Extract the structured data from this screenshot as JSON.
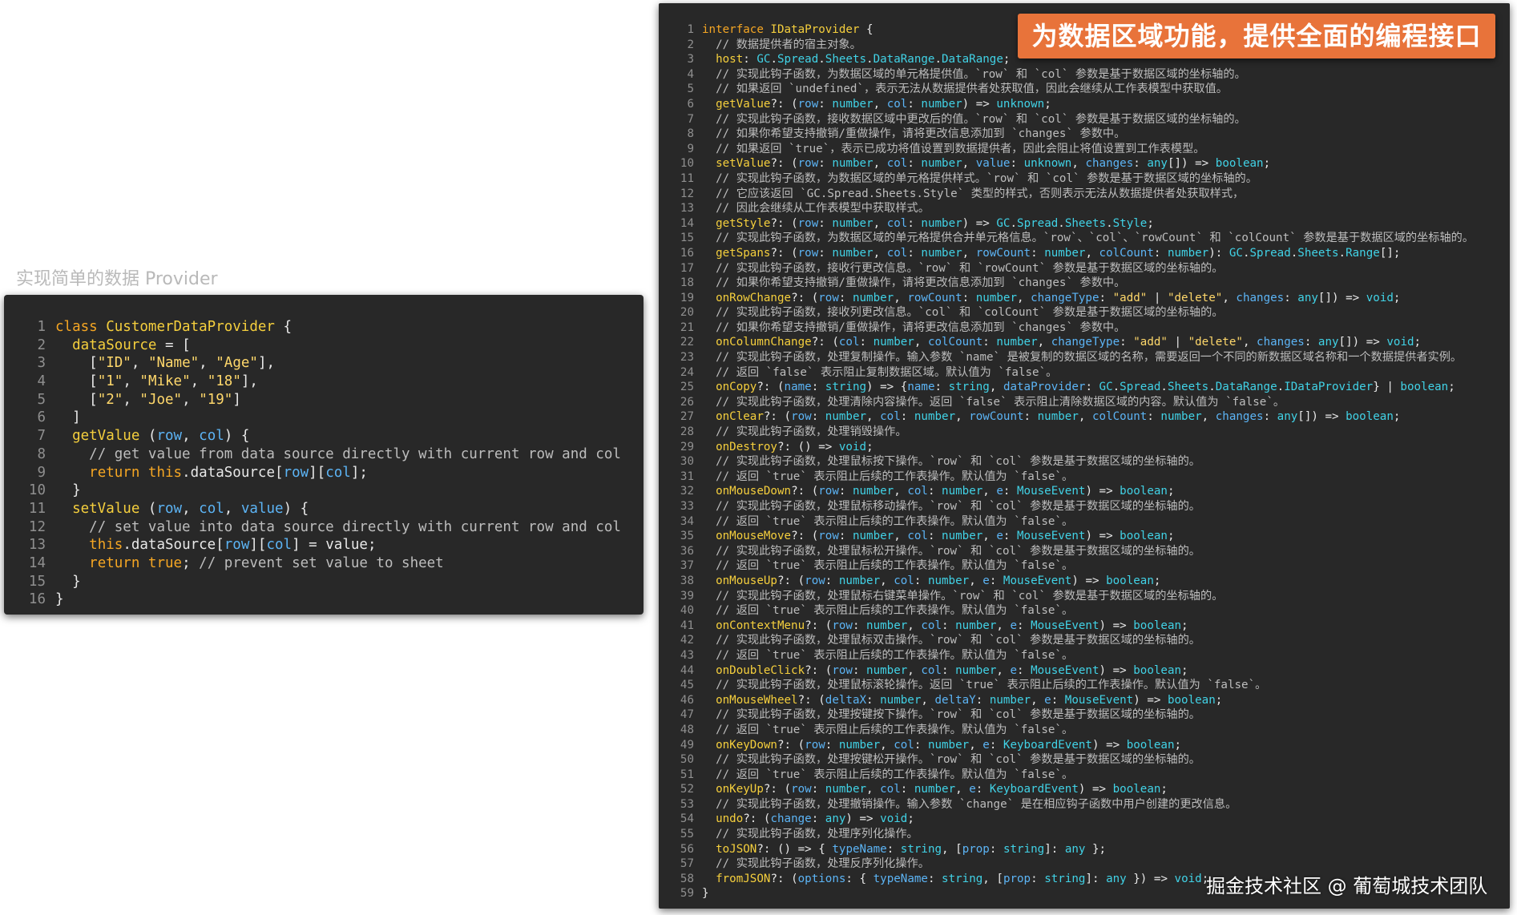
{
  "caption": "实现简单的数据 Provider",
  "banner": "为数据区域功能，提供全面的编程接口",
  "watermark": "掘金技术社区 @ 葡萄城技术团队",
  "colors": {
    "panel_bg": "#282828",
    "banner_bg": "#e8733a",
    "keyword": "#f5a623",
    "identifier": "#f5cf3d",
    "string": "#ffd86b",
    "param": "#5cb4f5",
    "type": "#41d2e6",
    "comment": "#bdbdbd"
  },
  "left_code": [
    {
      "n": "1",
      "t": "class CustomerDataProvider {"
    },
    {
      "n": "2",
      "t": "  dataSource = ["
    },
    {
      "n": "3",
      "t": "    [\"ID\", \"Name\", \"Age\"],"
    },
    {
      "n": "4",
      "t": "    [\"1\", \"Mike\", \"18\"],"
    },
    {
      "n": "5",
      "t": "    [\"2\", \"Joe\", \"19\"]"
    },
    {
      "n": "6",
      "t": "  ]"
    },
    {
      "n": "7",
      "t": "  getValue (row, col) {"
    },
    {
      "n": "8",
      "t": "    // get value from data source directly with current row and col"
    },
    {
      "n": "9",
      "t": "    return this.dataSource[row][col];"
    },
    {
      "n": "10",
      "t": "  }"
    },
    {
      "n": "11",
      "t": "  setValue (row, col, value) {"
    },
    {
      "n": "12",
      "t": "    // set value into data source directly with current row and col"
    },
    {
      "n": "13",
      "t": "    this.dataSource[row][col] = value;"
    },
    {
      "n": "14",
      "t": "    return true; // prevent set value to sheet"
    },
    {
      "n": "15",
      "t": "  }"
    },
    {
      "n": "16",
      "t": "}"
    }
  ],
  "right_code": [
    {
      "n": "1",
      "t": "interface IDataProvider {"
    },
    {
      "n": "2",
      "t": "  // 数据提供者的宿主对象。"
    },
    {
      "n": "3",
      "t": "  host: GC.Spread.Sheets.DataRange.DataRange;"
    },
    {
      "n": "4",
      "t": "  // 实现此钩子函数，为数据区域的单元格提供值。`row` 和 `col` 参数是基于数据区域的坐标轴的。"
    },
    {
      "n": "5",
      "t": "  // 如果返回 `undefined`，表示无法从数据提供者处获取值，因此会继续从工作表模型中获取值。"
    },
    {
      "n": "6",
      "t": "  getValue?: (row: number, col: number) => unknown;"
    },
    {
      "n": "7",
      "t": "  // 实现此钩子函数，接收数据区域中更改后的值。`row` 和 `col` 参数是基于数据区域的坐标轴的。"
    },
    {
      "n": "8",
      "t": "  // 如果你希望支持撤销/重做操作，请将更改信息添加到 `changes` 参数中。"
    },
    {
      "n": "9",
      "t": "  // 如果返回 `true`，表示已成功将值设置到数据提供者，因此会阻止将值设置到工作表模型。"
    },
    {
      "n": "10",
      "t": "  setValue?: (row: number, col: number, value: unknown, changes: any[]) => boolean;"
    },
    {
      "n": "11",
      "t": "  // 实现此钩子函数，为数据区域的单元格提供样式。`row` 和 `col` 参数是基于数据区域的坐标轴的。"
    },
    {
      "n": "12",
      "t": "  // 它应该返回 `GC.Spread.Sheets.Style` 类型的样式，否则表示无法从数据提供者处获取样式，"
    },
    {
      "n": "13",
      "t": "  // 因此会继续从工作表模型中获取样式。"
    },
    {
      "n": "14",
      "t": "  getStyle?: (row: number, col: number) => GC.Spread.Sheets.Style;"
    },
    {
      "n": "15",
      "t": "  // 实现此钩子函数，为数据区域的单元格提供合并单元格信息。`row`、`col`、`rowCount` 和 `colCount` 参数是基于数据区域的坐标轴的。"
    },
    {
      "n": "16",
      "t": "  getSpans?: (row: number, col: number, rowCount: number, colCount: number): GC.Spread.Sheets.Range[];"
    },
    {
      "n": "17",
      "t": "  // 实现此钩子函数，接收行更改信息。`row` 和 `rowCount` 参数是基于数据区域的坐标轴的。"
    },
    {
      "n": "18",
      "t": "  // 如果你希望支持撤销/重做操作，请将更改信息添加到 `changes` 参数中。"
    },
    {
      "n": "19",
      "t": "  onRowChange?: (row: number, rowCount: number, changeType: \"add\" | \"delete\", changes: any[]) => void;"
    },
    {
      "n": "20",
      "t": "  // 实现此钩子函数，接收列更改信息。`col` 和 `colCount` 参数是基于数据区域的坐标轴的。"
    },
    {
      "n": "21",
      "t": "  // 如果你希望支持撤销/重做操作，请将更改信息添加到 `changes` 参数中。"
    },
    {
      "n": "22",
      "t": "  onColumnChange?: (col: number, colCount: number, changeType: \"add\" | \"delete\", changes: any[]) => void;"
    },
    {
      "n": "23",
      "t": "  // 实现此钩子函数，处理复制操作。输入参数 `name` 是被复制的数据区域的名称，需要返回一个不同的新数据区域名称和一个数据提供者实例。"
    },
    {
      "n": "24",
      "t": "  // 返回 `false` 表示阻止复制数据区域。默认值为 `false`。"
    },
    {
      "n": "25",
      "t": "  onCopy?: (name: string) => {name: string, dataProvider: GC.Spread.Sheets.DataRange.IDataProvider} | boolean;"
    },
    {
      "n": "26",
      "t": "  // 实现此钩子函数，处理清除内容操作。返回 `false` 表示阻止清除数据区域的内容。默认值为 `false`。"
    },
    {
      "n": "27",
      "t": "  onClear?: (row: number, col: number, rowCount: number, colCount: number, changes: any[]) => boolean;"
    },
    {
      "n": "28",
      "t": "  // 实现此钩子函数，处理销毁操作。"
    },
    {
      "n": "29",
      "t": "  onDestroy?: () => void;"
    },
    {
      "n": "30",
      "t": "  // 实现此钩子函数，处理鼠标按下操作。`row` 和 `col` 参数是基于数据区域的坐标轴的。"
    },
    {
      "n": "31",
      "t": "  // 返回 `true` 表示阻止后续的工作表操作。默认值为 `false`。"
    },
    {
      "n": "32",
      "t": "  onMouseDown?: (row: number, col: number, e: MouseEvent) => boolean;"
    },
    {
      "n": "33",
      "t": "  // 实现此钩子函数，处理鼠标移动操作。`row` 和 `col` 参数是基于数据区域的坐标轴的。"
    },
    {
      "n": "34",
      "t": "  // 返回 `true` 表示阻止后续的工作表操作。默认值为 `false`。"
    },
    {
      "n": "35",
      "t": "  onMouseMove?: (row: number, col: number, e: MouseEvent) => boolean;"
    },
    {
      "n": "36",
      "t": "  // 实现此钩子函数，处理鼠标松开操作。`row` 和 `col` 参数是基于数据区域的坐标轴的。"
    },
    {
      "n": "37",
      "t": "  // 返回 `true` 表示阻止后续的工作表操作。默认值为 `false`。"
    },
    {
      "n": "38",
      "t": "  onMouseUp?: (row: number, col: number, e: MouseEvent) => boolean;"
    },
    {
      "n": "39",
      "t": "  // 实现此钩子函数，处理鼠标右键菜单操作。`row` 和 `col` 参数是基于数据区域的坐标轴的。"
    },
    {
      "n": "40",
      "t": "  // 返回 `true` 表示阻止后续的工作表操作。默认值为 `false`。"
    },
    {
      "n": "41",
      "t": "  onContextMenu?: (row: number, col: number, e: MouseEvent) => boolean;"
    },
    {
      "n": "42",
      "t": "  // 实现此钩子函数，处理鼠标双击操作。`row` 和 `col` 参数是基于数据区域的坐标轴的。"
    },
    {
      "n": "43",
      "t": "  // 返回 `true` 表示阻止后续的工作表操作。默认值为 `false`。"
    },
    {
      "n": "44",
      "t": "  onDoubleClick?: (row: number, col: number, e: MouseEvent) => boolean;"
    },
    {
      "n": "45",
      "t": "  // 实现此钩子函数，处理鼠标滚轮操作。返回 `true` 表示阻止后续的工作表操作。默认值为 `false`。"
    },
    {
      "n": "46",
      "t": "  onMouseWheel?: (deltaX: number, deltaY: number, e: MouseEvent) => boolean;"
    },
    {
      "n": "47",
      "t": "  // 实现此钩子函数，处理按键按下操作。`row` 和 `col` 参数是基于数据区域的坐标轴的。"
    },
    {
      "n": "48",
      "t": "  // 返回 `true` 表示阻止后续的工作表操作。默认值为 `false`。"
    },
    {
      "n": "49",
      "t": "  onKeyDown?: (row: number, col: number, e: KeyboardEvent) => boolean;"
    },
    {
      "n": "50",
      "t": "  // 实现此钩子函数，处理按键松开操作。`row` 和 `col` 参数是基于数据区域的坐标轴的。"
    },
    {
      "n": "51",
      "t": "  // 返回 `true` 表示阻止后续的工作表操作。默认值为 `false`。"
    },
    {
      "n": "52",
      "t": "  onKeyUp?: (row: number, col: number, e: KeyboardEvent) => boolean;"
    },
    {
      "n": "53",
      "t": "  // 实现此钩子函数，处理撤销操作。输入参数 `change` 是在相应钩子函数中用户创建的更改信息。"
    },
    {
      "n": "54",
      "t": "  undo?: (change: any) => void;"
    },
    {
      "n": "55",
      "t": "  // 实现此钩子函数，处理序列化操作。"
    },
    {
      "n": "56",
      "t": "  toJSON?: () => { typeName: string, [prop: string]: any };"
    },
    {
      "n": "57",
      "t": "  // 实现此钩子函数，处理反序列化操作。"
    },
    {
      "n": "58",
      "t": "  fromJSON?: (options: { typeName: string, [prop: string]: any }) => void;"
    },
    {
      "n": "59",
      "t": "}"
    }
  ]
}
